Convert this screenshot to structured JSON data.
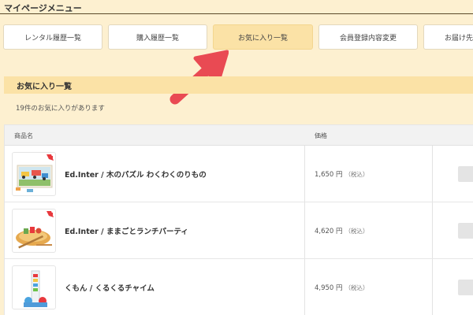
{
  "menu": {
    "title": "マイページメニュー",
    "tabs": [
      {
        "label": "レンタル履歴一覧"
      },
      {
        "label": "購入履歴一覧"
      },
      {
        "label": "お気に入り一覧"
      },
      {
        "label": "会員登録内容変更"
      },
      {
        "label": "お届け先追加"
      }
    ]
  },
  "favorites": {
    "heading": "お気に入り一覧",
    "count_text": "19件のお気に入りがあります"
  },
  "table": {
    "headers": {
      "name": "商品名",
      "price": "価格"
    },
    "rows": [
      {
        "name": "Ed.Inter / 木のパズル わくわくのりもの",
        "price": "1,650 円",
        "tax": "（税込）"
      },
      {
        "name": "Ed.Inter / ままごとランチパーティ",
        "price": "4,620 円",
        "tax": "（税込）"
      },
      {
        "name": "くもん / くるくるチャイム",
        "price": "4,950 円",
        "tax": "（税込）"
      }
    ]
  },
  "colors": {
    "background": "#fdf0d0",
    "active_tab": "#fbe2a6",
    "arrow": "#e94a53"
  }
}
